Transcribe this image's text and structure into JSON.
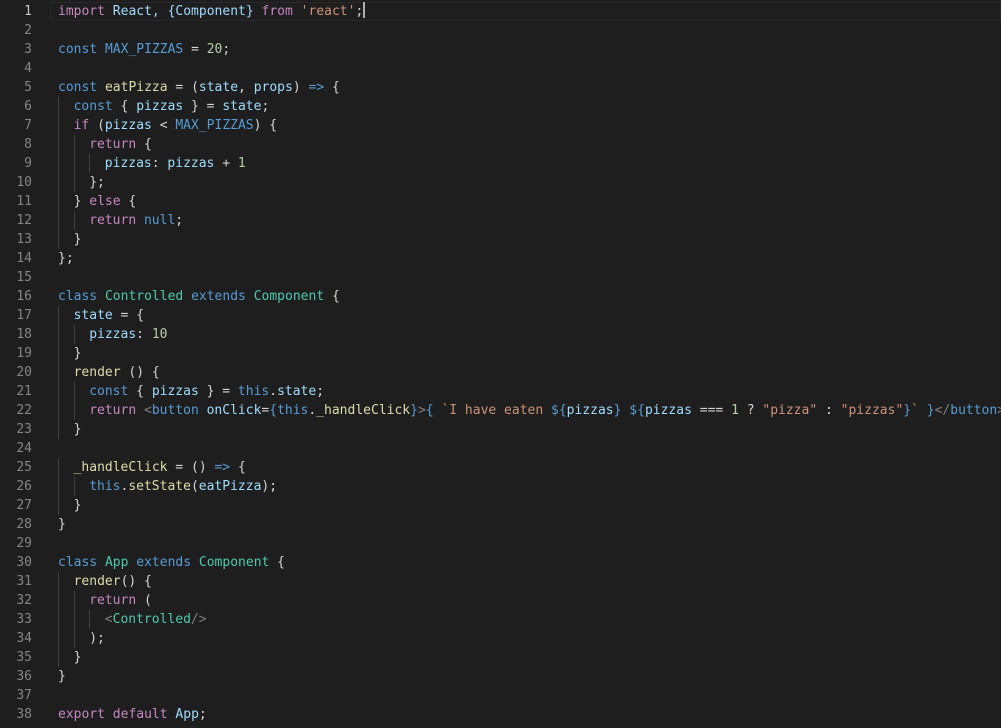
{
  "editor": {
    "active_line": 1,
    "cursor_line": 1,
    "lines": [
      {
        "num": "1",
        "indent": 0,
        "tokens": [
          {
            "t": "import",
            "c": "kw"
          },
          {
            "t": " React, {Component} ",
            "c": "id"
          },
          {
            "t": "from",
            "c": "kw"
          },
          {
            "t": " ",
            "c": "pl"
          },
          {
            "t": "'react'",
            "c": "str"
          },
          {
            "t": ";",
            "c": "pl"
          }
        ]
      },
      {
        "num": "2",
        "indent": 0,
        "tokens": []
      },
      {
        "num": "3",
        "indent": 0,
        "tokens": [
          {
            "t": "const",
            "c": "st"
          },
          {
            "t": " ",
            "c": "pl"
          },
          {
            "t": "MAX_PIZZAS",
            "c": "st"
          },
          {
            "t": " = ",
            "c": "pl"
          },
          {
            "t": "20",
            "c": "num"
          },
          {
            "t": ";",
            "c": "pl"
          }
        ]
      },
      {
        "num": "4",
        "indent": 0,
        "tokens": []
      },
      {
        "num": "5",
        "indent": 0,
        "tokens": [
          {
            "t": "const",
            "c": "st"
          },
          {
            "t": " ",
            "c": "pl"
          },
          {
            "t": "eatPizza",
            "c": "fn"
          },
          {
            "t": " = (",
            "c": "pl"
          },
          {
            "t": "state",
            "c": "id"
          },
          {
            "t": ", ",
            "c": "pl"
          },
          {
            "t": "props",
            "c": "id"
          },
          {
            "t": ") ",
            "c": "pl"
          },
          {
            "t": "=>",
            "c": "st"
          },
          {
            "t": " {",
            "c": "pl"
          }
        ]
      },
      {
        "num": "6",
        "indent": 1,
        "tokens": [
          {
            "t": "const",
            "c": "st"
          },
          {
            "t": " { ",
            "c": "pl"
          },
          {
            "t": "pizzas",
            "c": "id"
          },
          {
            "t": " } = ",
            "c": "pl"
          },
          {
            "t": "state",
            "c": "id"
          },
          {
            "t": ";",
            "c": "pl"
          }
        ]
      },
      {
        "num": "7",
        "indent": 1,
        "tokens": [
          {
            "t": "if",
            "c": "kw"
          },
          {
            "t": " (",
            "c": "pl"
          },
          {
            "t": "pizzas",
            "c": "id"
          },
          {
            "t": " < ",
            "c": "pl"
          },
          {
            "t": "MAX_PIZZAS",
            "c": "st"
          },
          {
            "t": ") {",
            "c": "pl"
          }
        ]
      },
      {
        "num": "8",
        "indent": 2,
        "tokens": [
          {
            "t": "return",
            "c": "kw"
          },
          {
            "t": " {",
            "c": "pl"
          }
        ]
      },
      {
        "num": "9",
        "indent": 3,
        "tokens": [
          {
            "t": "pizzas",
            "c": "id"
          },
          {
            "t": ": ",
            "c": "pl"
          },
          {
            "t": "pizzas",
            "c": "id"
          },
          {
            "t": " + ",
            "c": "pl"
          },
          {
            "t": "1",
            "c": "num"
          }
        ]
      },
      {
        "num": "10",
        "indent": 2,
        "tokens": [
          {
            "t": "};",
            "c": "pl"
          }
        ]
      },
      {
        "num": "11",
        "indent": 1,
        "tokens": [
          {
            "t": "} ",
            "c": "pl"
          },
          {
            "t": "else",
            "c": "kw"
          },
          {
            "t": " {",
            "c": "pl"
          }
        ]
      },
      {
        "num": "12",
        "indent": 2,
        "tokens": [
          {
            "t": "return",
            "c": "kw"
          },
          {
            "t": " ",
            "c": "pl"
          },
          {
            "t": "null",
            "c": "st"
          },
          {
            "t": ";",
            "c": "pl"
          }
        ]
      },
      {
        "num": "13",
        "indent": 1,
        "tokens": [
          {
            "t": "}",
            "c": "pl"
          }
        ]
      },
      {
        "num": "14",
        "indent": 0,
        "tokens": [
          {
            "t": "};",
            "c": "pl"
          }
        ]
      },
      {
        "num": "15",
        "indent": 0,
        "tokens": []
      },
      {
        "num": "16",
        "indent": 0,
        "tokens": [
          {
            "t": "class",
            "c": "st"
          },
          {
            "t": " ",
            "c": "pl"
          },
          {
            "t": "Controlled",
            "c": "cls"
          },
          {
            "t": " ",
            "c": "pl"
          },
          {
            "t": "extends",
            "c": "st"
          },
          {
            "t": " ",
            "c": "pl"
          },
          {
            "t": "Component",
            "c": "cls"
          },
          {
            "t": " {",
            "c": "pl"
          }
        ]
      },
      {
        "num": "17",
        "indent": 1,
        "tokens": [
          {
            "t": "state",
            "c": "id"
          },
          {
            "t": " = {",
            "c": "pl"
          }
        ]
      },
      {
        "num": "18",
        "indent": 2,
        "tokens": [
          {
            "t": "pizzas",
            "c": "id"
          },
          {
            "t": ": ",
            "c": "pl"
          },
          {
            "t": "10",
            "c": "num"
          }
        ]
      },
      {
        "num": "19",
        "indent": 1,
        "tokens": [
          {
            "t": "}",
            "c": "pl"
          }
        ]
      },
      {
        "num": "20",
        "indent": 1,
        "tokens": [
          {
            "t": "render",
            "c": "fn"
          },
          {
            "t": " () {",
            "c": "pl"
          }
        ]
      },
      {
        "num": "21",
        "indent": 2,
        "tokens": [
          {
            "t": "const",
            "c": "st"
          },
          {
            "t": " { ",
            "c": "pl"
          },
          {
            "t": "pizzas",
            "c": "id"
          },
          {
            "t": " } = ",
            "c": "pl"
          },
          {
            "t": "this",
            "c": "st"
          },
          {
            "t": ".",
            "c": "pl"
          },
          {
            "t": "state",
            "c": "id"
          },
          {
            "t": ";",
            "c": "pl"
          }
        ]
      },
      {
        "num": "22",
        "indent": 2,
        "tokens": [
          {
            "t": "return",
            "c": "kw"
          },
          {
            "t": " ",
            "c": "pl"
          },
          {
            "t": "<",
            "c": "tag"
          },
          {
            "t": "button",
            "c": "st"
          },
          {
            "t": " ",
            "c": "pl"
          },
          {
            "t": "onClick",
            "c": "id"
          },
          {
            "t": "=",
            "c": "pl"
          },
          {
            "t": "{",
            "c": "st"
          },
          {
            "t": "this",
            "c": "st"
          },
          {
            "t": ".",
            "c": "pl"
          },
          {
            "t": "_handleClick",
            "c": "fn"
          },
          {
            "t": "}",
            "c": "st"
          },
          {
            "t": ">",
            "c": "tag"
          },
          {
            "t": "{",
            "c": "st"
          },
          {
            "t": " ",
            "c": "pl"
          },
          {
            "t": "`I have eaten ",
            "c": "str"
          },
          {
            "t": "${",
            "c": "st"
          },
          {
            "t": "pizzas",
            "c": "id"
          },
          {
            "t": "}",
            "c": "st"
          },
          {
            "t": " ",
            "c": "str"
          },
          {
            "t": "${",
            "c": "st"
          },
          {
            "t": "pizzas",
            "c": "id"
          },
          {
            "t": " === ",
            "c": "pl"
          },
          {
            "t": "1",
            "c": "num"
          },
          {
            "t": " ? ",
            "c": "pl"
          },
          {
            "t": "\"pizza\"",
            "c": "str"
          },
          {
            "t": " : ",
            "c": "pl"
          },
          {
            "t": "\"pizzas\"",
            "c": "str"
          },
          {
            "t": "}",
            "c": "st"
          },
          {
            "t": "`",
            "c": "str"
          },
          {
            "t": " ",
            "c": "pl"
          },
          {
            "t": "}",
            "c": "st"
          },
          {
            "t": "</",
            "c": "tag"
          },
          {
            "t": "button",
            "c": "st"
          },
          {
            "t": ">",
            "c": "tag"
          }
        ]
      },
      {
        "num": "23",
        "indent": 1,
        "tokens": [
          {
            "t": "}",
            "c": "pl"
          }
        ]
      },
      {
        "num": "24",
        "indent": 0,
        "tokens": []
      },
      {
        "num": "25",
        "indent": 1,
        "tokens": [
          {
            "t": "_handleClick",
            "c": "fn"
          },
          {
            "t": " = () ",
            "c": "pl"
          },
          {
            "t": "=>",
            "c": "st"
          },
          {
            "t": " {",
            "c": "pl"
          }
        ]
      },
      {
        "num": "26",
        "indent": 2,
        "tokens": [
          {
            "t": "this",
            "c": "st"
          },
          {
            "t": ".",
            "c": "pl"
          },
          {
            "t": "setState",
            "c": "fn"
          },
          {
            "t": "(",
            "c": "pl"
          },
          {
            "t": "eatPizza",
            "c": "id"
          },
          {
            "t": ");",
            "c": "pl"
          }
        ]
      },
      {
        "num": "27",
        "indent": 1,
        "tokens": [
          {
            "t": "}",
            "c": "pl"
          }
        ]
      },
      {
        "num": "28",
        "indent": 0,
        "tokens": [
          {
            "t": "}",
            "c": "pl"
          }
        ]
      },
      {
        "num": "29",
        "indent": 0,
        "tokens": []
      },
      {
        "num": "30",
        "indent": 0,
        "tokens": [
          {
            "t": "class",
            "c": "st"
          },
          {
            "t": " ",
            "c": "pl"
          },
          {
            "t": "App",
            "c": "cls"
          },
          {
            "t": " ",
            "c": "pl"
          },
          {
            "t": "extends",
            "c": "st"
          },
          {
            "t": " ",
            "c": "pl"
          },
          {
            "t": "Component",
            "c": "cls"
          },
          {
            "t": " {",
            "c": "pl"
          }
        ]
      },
      {
        "num": "31",
        "indent": 1,
        "tokens": [
          {
            "t": "render",
            "c": "fn"
          },
          {
            "t": "() {",
            "c": "pl"
          }
        ]
      },
      {
        "num": "32",
        "indent": 2,
        "tokens": [
          {
            "t": "return",
            "c": "kw"
          },
          {
            "t": " (",
            "c": "pl"
          }
        ]
      },
      {
        "num": "33",
        "indent": 3,
        "tokens": [
          {
            "t": "<",
            "c": "tag"
          },
          {
            "t": "Controlled",
            "c": "cls"
          },
          {
            "t": "/>",
            "c": "tag"
          }
        ]
      },
      {
        "num": "34",
        "indent": 2,
        "tokens": [
          {
            "t": ");",
            "c": "pl"
          }
        ]
      },
      {
        "num": "35",
        "indent": 1,
        "tokens": [
          {
            "t": "}",
            "c": "pl"
          }
        ]
      },
      {
        "num": "36",
        "indent": 0,
        "tokens": [
          {
            "t": "}",
            "c": "pl"
          }
        ]
      },
      {
        "num": "37",
        "indent": 0,
        "tokens": []
      },
      {
        "num": "38",
        "indent": 0,
        "tokens": [
          {
            "t": "export",
            "c": "kw"
          },
          {
            "t": " ",
            "c": "pl"
          },
          {
            "t": "default",
            "c": "kw"
          },
          {
            "t": " ",
            "c": "pl"
          },
          {
            "t": "App",
            "c": "id"
          },
          {
            "t": ";",
            "c": "pl"
          }
        ]
      }
    ]
  },
  "colors": {
    "background": "#1e1e1e",
    "keyword": "#c586c0",
    "storage": "#569cd6",
    "identifier": "#9cdcfe",
    "class": "#4ec9b0",
    "function": "#dcdcaa",
    "string": "#ce9178",
    "number": "#b5cea8",
    "tag_bracket": "#808080",
    "plain": "#d4d4d4",
    "line_number": "#858585"
  }
}
